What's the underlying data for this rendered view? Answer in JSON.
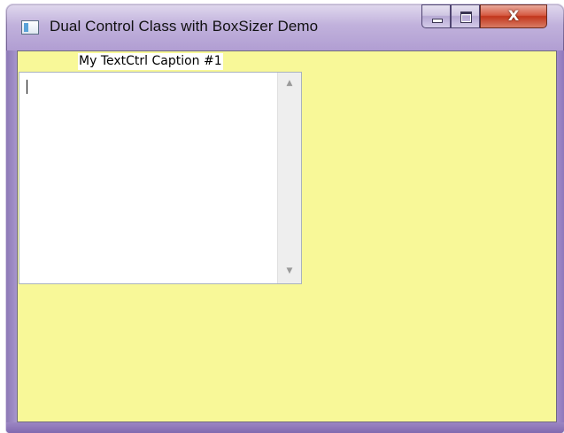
{
  "window": {
    "title": "Dual Control Class with BoxSizer Demo",
    "app_icon": "window-app-icon",
    "client_background": "#f8f898",
    "frame_color": "#9f87c6"
  },
  "caption_buttons": {
    "minimize_icon": "minimize-icon",
    "maximize_icon": "maximize-icon",
    "close_label": "X"
  },
  "content": {
    "caption_label": "My TextCtrl Caption #1",
    "textctrl_value": "",
    "scroll_up_glyph": "▲",
    "scroll_down_glyph": "▼"
  }
}
